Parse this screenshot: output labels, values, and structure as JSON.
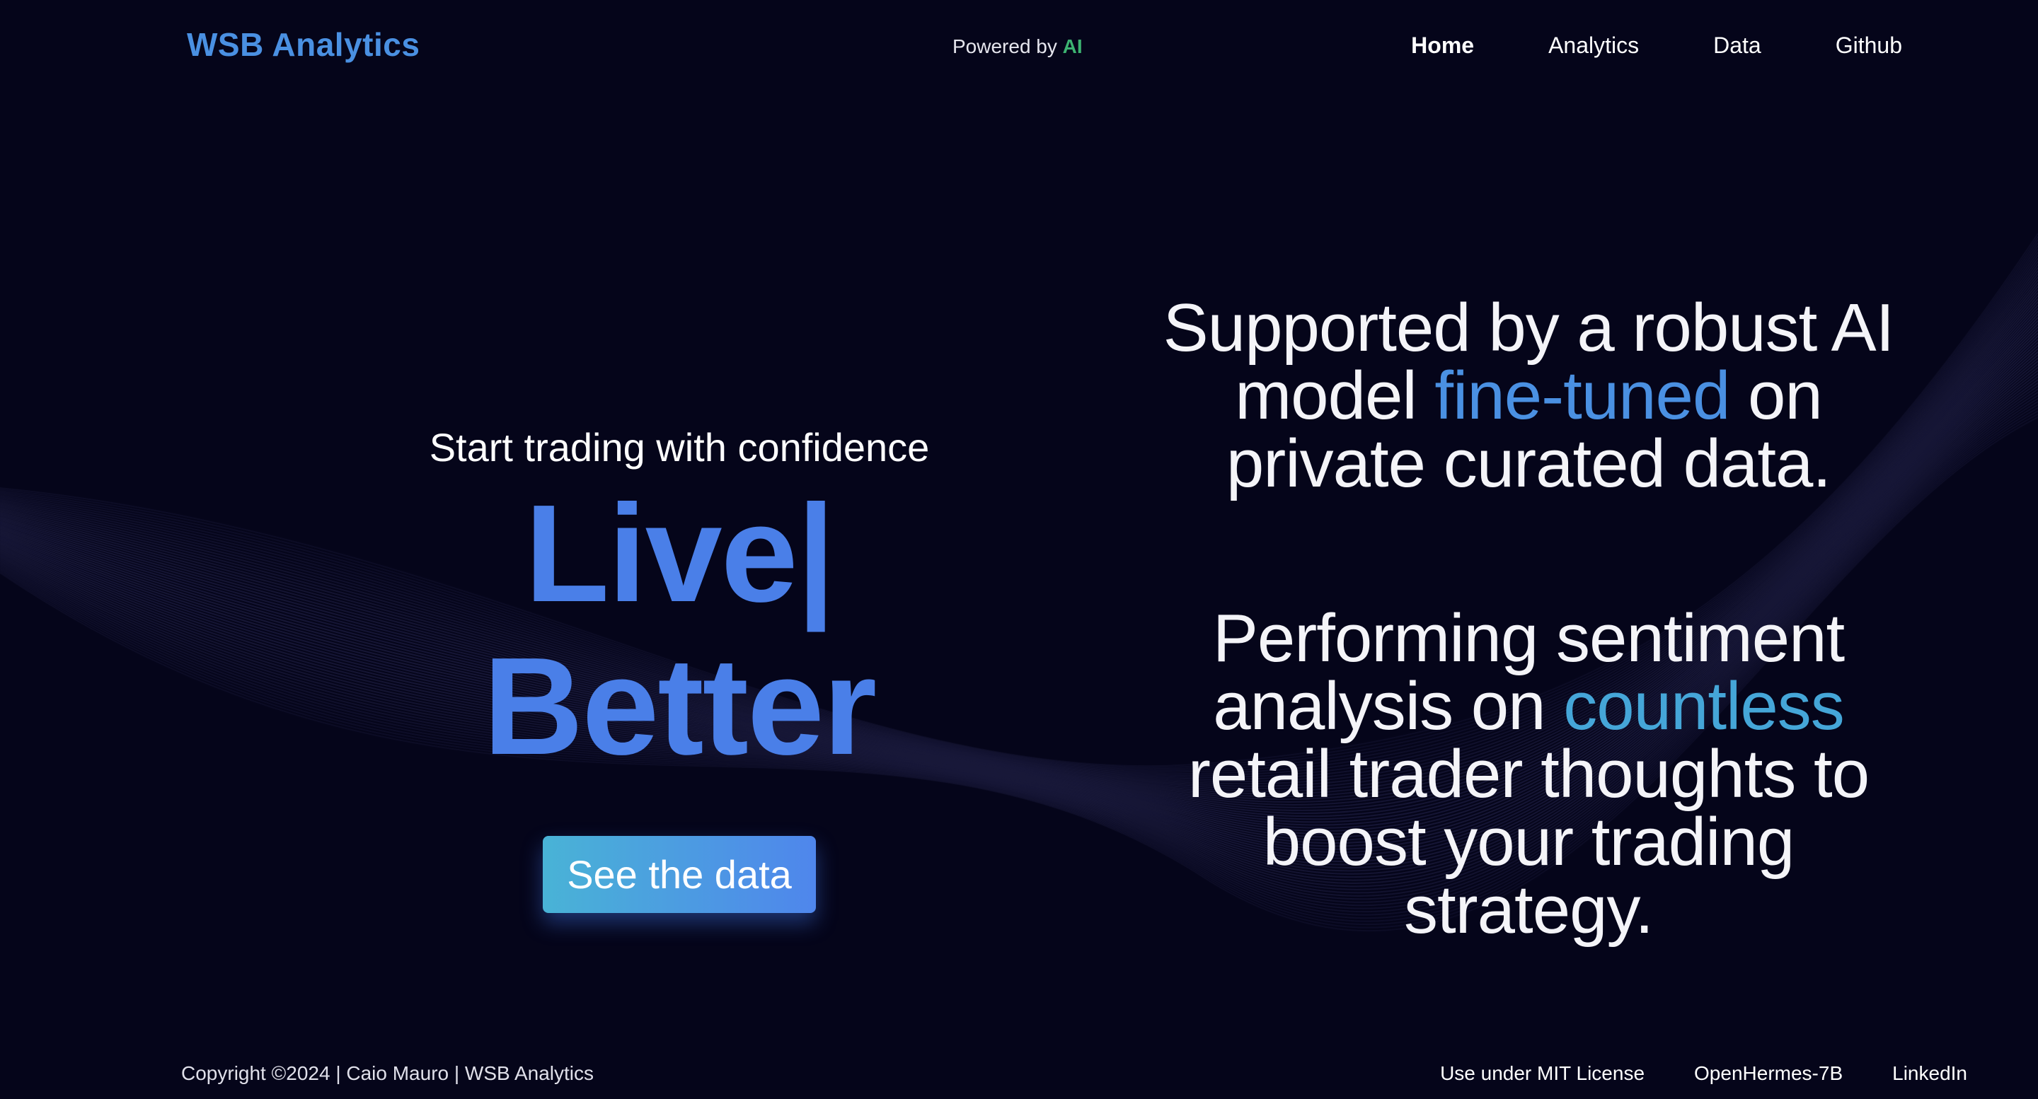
{
  "header": {
    "brand": "WSB Analytics",
    "powered_prefix": "Powered by",
    "powered_ai": "AI",
    "nav": [
      {
        "label": "Home",
        "active": true
      },
      {
        "label": "Analytics",
        "active": false
      },
      {
        "label": "Data",
        "active": false
      },
      {
        "label": "Github",
        "active": false
      }
    ]
  },
  "hero": {
    "tagline": "Start trading with confidence",
    "headline_word1": "Live",
    "headline_caret": "|",
    "headline_word2": " Better",
    "cta_label": "See the data"
  },
  "feature_one": {
    "line1": "Supported by a robust AI",
    "line2_pre": "model ",
    "line2_highlight": "fine-tuned",
    "line2_post": " on",
    "line3": "private curated data."
  },
  "feature_two": {
    "line1": "Performing sentiment",
    "line2_pre": "analysis on ",
    "line2_highlight": "countless",
    "line3": "retail trader thoughts to",
    "line4": "boost your trading",
    "line5": "strategy."
  },
  "footer": {
    "copyright": "Copyright ©2024 | Caio Mauro | WSB Analytics",
    "links": [
      "Use under MIT License",
      "OpenHermes-7B",
      "LinkedIn"
    ]
  },
  "colors": {
    "background": "#05051a",
    "brand": "#4a90e2",
    "ai_accent": "#3cb371",
    "headline": "#4a7fe8",
    "cta_gradient_start": "#49b3d6",
    "cta_gradient_end": "#4f86ec"
  }
}
